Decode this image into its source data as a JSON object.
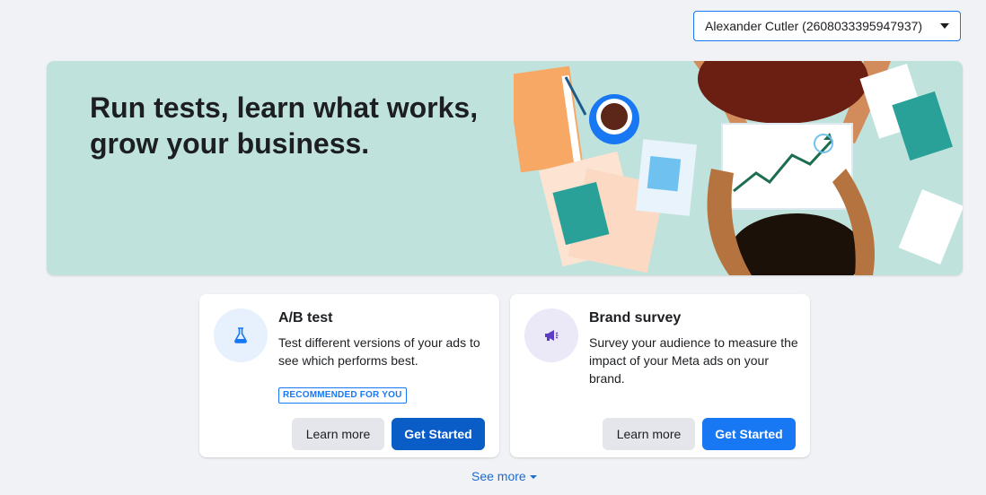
{
  "account": {
    "selected": "Alexander Cutler (2608033395947937)"
  },
  "hero": {
    "title": "Run tests, learn what works, grow your business."
  },
  "cards": [
    {
      "title": "A/B test",
      "description": "Test different versions of your ads to see which performs best.",
      "badge": "RECOMMENDED FOR YOU",
      "learn_more": "Learn more",
      "get_started": "Get Started",
      "icon": "flask-icon"
    },
    {
      "title": "Brand survey",
      "description": "Survey your audience to measure the impact of your Meta ads on your brand.",
      "learn_more": "Learn more",
      "get_started": "Get Started",
      "icon": "megaphone-icon"
    }
  ],
  "see_more": "See more",
  "colors": {
    "accent": "#1877f2",
    "hero_bg": "#bfe3dc",
    "page_bg": "#f0f2f5"
  }
}
